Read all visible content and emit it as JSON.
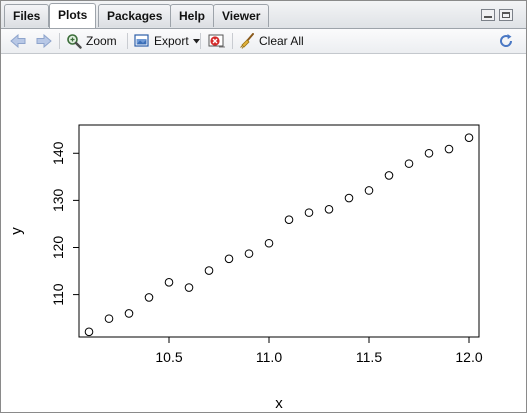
{
  "tabs": [
    {
      "label": "Files"
    },
    {
      "label": "Plots"
    },
    {
      "label": "Packages"
    },
    {
      "label": "Help"
    },
    {
      "label": "Viewer"
    }
  ],
  "toolbar": {
    "zoom_label": "Zoom",
    "export_label": "Export",
    "clear_all_label": "Clear All"
  },
  "icons": {
    "back": "arrow-left-icon",
    "forward": "arrow-right-icon",
    "zoom": "magnifier-icon",
    "export": "export-image-icon",
    "remove": "remove-plot-icon",
    "clear": "broom-icon",
    "refresh": "refresh-icon"
  },
  "chart_data": {
    "type": "scatter",
    "xlabel": "x",
    "ylabel": "y",
    "xlim": [
      10.05,
      12.05
    ],
    "ylim": [
      101,
      146
    ],
    "x_ticks": [
      "10.5",
      "11.0",
      "11.5",
      "12.0"
    ],
    "y_ticks": [
      "110",
      "120",
      "130",
      "140"
    ],
    "points": [
      {
        "x": 10.1,
        "y": 102.1
      },
      {
        "x": 10.2,
        "y": 104.9
      },
      {
        "x": 10.3,
        "y": 106.0
      },
      {
        "x": 10.4,
        "y": 109.4
      },
      {
        "x": 10.5,
        "y": 112.6
      },
      {
        "x": 10.6,
        "y": 111.5
      },
      {
        "x": 10.7,
        "y": 115.1
      },
      {
        "x": 10.8,
        "y": 117.6
      },
      {
        "x": 10.9,
        "y": 118.7
      },
      {
        "x": 11.0,
        "y": 120.9
      },
      {
        "x": 11.1,
        "y": 125.9
      },
      {
        "x": 11.2,
        "y": 127.4
      },
      {
        "x": 11.3,
        "y": 128.1
      },
      {
        "x": 11.4,
        "y": 130.5
      },
      {
        "x": 11.5,
        "y": 132.1
      },
      {
        "x": 11.6,
        "y": 135.3
      },
      {
        "x": 11.7,
        "y": 137.8
      },
      {
        "x": 11.8,
        "y": 140.0
      },
      {
        "x": 11.9,
        "y": 140.9
      },
      {
        "x": 12.0,
        "y": 143.3
      }
    ]
  }
}
